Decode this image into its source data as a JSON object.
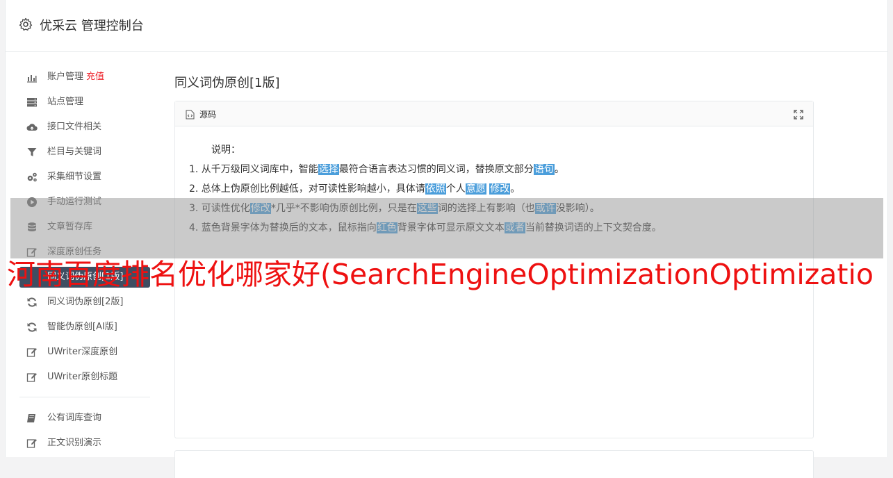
{
  "header": {
    "title": "优采云 管理控制台",
    "icon": "gear-icon"
  },
  "sidebar": {
    "items": [
      {
        "label": "账户管理",
        "badge": "充值",
        "icon": "bar-chart-icon"
      },
      {
        "label": "站点管理",
        "icon": "server-icon"
      },
      {
        "label": "接口文件相关",
        "icon": "cloud-upload-icon"
      },
      {
        "label": "栏目与关键词",
        "icon": "filter-icon"
      },
      {
        "label": "采集细节设置",
        "icon": "gears-icon"
      },
      {
        "label": "手动运行测试",
        "icon": "play-circle-icon"
      },
      {
        "label": "文章暂存库",
        "icon": "database-icon"
      },
      {
        "label": "深度原创任务",
        "icon": "edit-icon"
      },
      {
        "label": "同义词伪原创[1版]",
        "icon": "refresh-icon",
        "active": true
      },
      {
        "label": "同义词伪原创[2版]",
        "icon": "refresh-icon"
      },
      {
        "label": "智能伪原创[AI版]",
        "icon": "refresh-icon"
      },
      {
        "label": "UWriter深度原创",
        "icon": "edit-icon"
      },
      {
        "label": "UWriter原创标题",
        "icon": "edit-icon"
      }
    ],
    "items2": [
      {
        "label": "公有词库查询",
        "icon": "book-icon"
      },
      {
        "label": "正文识别演示",
        "icon": "edit-icon"
      }
    ]
  },
  "main": {
    "title": "同义词伪原创[1版]",
    "panel": {
      "label": "源码",
      "intro": "说明：",
      "lines": [
        [
          {
            "t": "1. 从千万级同义词库中，智能"
          },
          {
            "t": "选择",
            "h": true
          },
          {
            "t": "最符合语言表达习惯的同义词，替换原文部分"
          },
          {
            "t": "语句",
            "h": true
          },
          {
            "t": "。"
          }
        ],
        [
          {
            "t": "2. 总体上伪原创比例越低，对可读性影响越小，具体请"
          },
          {
            "t": "依照",
            "h": true
          },
          {
            "t": "个人"
          },
          {
            "t": "意愿",
            "h": true
          },
          {
            "t": " "
          },
          {
            "t": "修改",
            "h": true
          },
          {
            "t": "。"
          }
        ],
        [
          {
            "t": "3. 可读性优化"
          },
          {
            "t": "修改",
            "h": true
          },
          {
            "t": "*几乎*不影响伪原创比例，只是在"
          },
          {
            "t": "这些",
            "h": true
          },
          {
            "t": "词的选择上有影响（也"
          },
          {
            "t": "或许",
            "h": true
          },
          {
            "t": "没影响）。"
          }
        ],
        [
          {
            "t": "4. 蓝色背景字体为替换后的文本，鼠标指向"
          },
          {
            "t": "红色",
            "h": true
          },
          {
            "t": "背景字体可显示原文文本"
          },
          {
            "t": "或者",
            "h": true
          },
          {
            "t": "当前替换词语的上下文契合度。"
          }
        ]
      ]
    }
  },
  "banner": {
    "text": "河南百度排名优化哪家好(SearchEngineOptimizationOptimizatio"
  },
  "colors": {
    "active": "#3f4e62",
    "highlight": "#4b9edb",
    "badge": "#ed1c24",
    "banner": "#ee1111"
  }
}
